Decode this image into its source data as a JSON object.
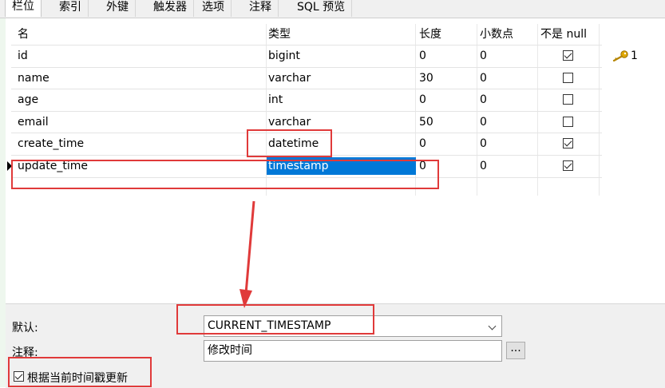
{
  "tabs": [
    {
      "label": "栏位",
      "active": true
    },
    {
      "label": "索引",
      "active": false
    },
    {
      "label": "外键",
      "active": false
    },
    {
      "label": "触发器",
      "active": false
    },
    {
      "label": "选项",
      "active": false
    },
    {
      "label": "注释",
      "active": false
    },
    {
      "label": "SQL 预览",
      "active": false
    }
  ],
  "columns": [
    "名",
    "类型",
    "长度",
    "小数点",
    "不是 null"
  ],
  "rows": [
    {
      "name": "id",
      "type": "bigint",
      "length": "0",
      "decimals": "0",
      "not_null": true,
      "key": "1"
    },
    {
      "name": "name",
      "type": "varchar",
      "length": "30",
      "decimals": "0",
      "not_null": false,
      "key": ""
    },
    {
      "name": "age",
      "type": "int",
      "length": "0",
      "decimals": "0",
      "not_null": false,
      "key": ""
    },
    {
      "name": "email",
      "type": "varchar",
      "length": "50",
      "decimals": "0",
      "not_null": false,
      "key": ""
    },
    {
      "name": "create_time",
      "type": "datetime",
      "length": "0",
      "decimals": "0",
      "not_null": true,
      "key": ""
    },
    {
      "name": "update_time",
      "type": "timestamp",
      "length": "0",
      "decimals": "0",
      "not_null": true,
      "key": "",
      "selected": true
    }
  ],
  "icons": {
    "primary_key": "key-icon",
    "row_pointer": "row-pointer-icon",
    "dropdown": "chevron-down-icon"
  },
  "colors": {
    "selection": "#0078d7",
    "annotation": "#e03a3a",
    "key": "#e0a800"
  },
  "properties": {
    "default_label": "默认:",
    "default_value": "CURRENT_TIMESTAMP",
    "comment_label": "注释:",
    "comment_value": "修改时间",
    "browse_label": "...",
    "update_on_current_label": "根据当前时间戳更新",
    "update_on_current_checked": true
  }
}
